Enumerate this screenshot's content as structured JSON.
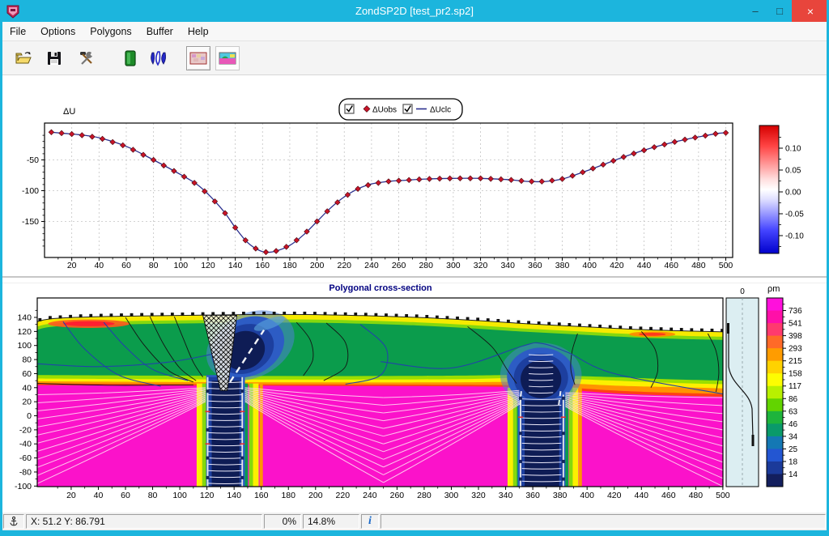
{
  "window": {
    "title": "ZondSP2D [test_pr2.sp2]",
    "minimize_label": "–",
    "maximize_label": "□",
    "close_label": "×",
    "titlebar_color": "#1cb5dd",
    "close_color": "#e8453c"
  },
  "menu": {
    "items": [
      "File",
      "Options",
      "Polygons",
      "Buffer",
      "Help"
    ]
  },
  "toolbar": {
    "buttons": [
      "open-file",
      "save-file",
      "tools-settings",
      "run-inversion",
      "wavelet-filter",
      "observed-data-view",
      "model-section-view"
    ]
  },
  "upper_chart": {
    "ylabel": "ΔU",
    "legend": [
      {
        "checked": true,
        "marker": "diamond",
        "label": "ΔUobs",
        "color": "#c81428"
      },
      {
        "checked": true,
        "marker": "line",
        "label": "ΔUclc",
        "color": "#2a2f8e"
      }
    ],
    "x_ticks": [
      20,
      40,
      60,
      80,
      100,
      120,
      140,
      160,
      180,
      200,
      220,
      240,
      260,
      280,
      300,
      320,
      340,
      360,
      380,
      400,
      420,
      440,
      460,
      480,
      500
    ],
    "y_ticks": [
      -50,
      -100,
      -150
    ],
    "colorbar_tick_labels": [
      "0.10",
      "0.05",
      "0.00",
      "-0.05",
      "-0.10"
    ]
  },
  "cross_section": {
    "title": "Polygonal cross-section",
    "x_ticks": [
      20,
      40,
      60,
      80,
      100,
      120,
      140,
      160,
      180,
      200,
      220,
      240,
      260,
      280,
      300,
      320,
      340,
      360,
      380,
      400,
      420,
      440,
      460,
      480,
      500
    ],
    "y_ticks": [
      140,
      120,
      100,
      80,
      60,
      40,
      20,
      0,
      -20,
      -40,
      -60,
      -80,
      -100
    ],
    "profile_axis_label": "0",
    "scale_label": "ρm",
    "scale_ticks": [
      736,
      541,
      398,
      293,
      215,
      158,
      117,
      86,
      63,
      46,
      34,
      25,
      18,
      14
    ],
    "scale_colors": [
      "#ff10dc",
      "#ff10a8",
      "#ff3a6e",
      "#ff6a28",
      "#ff9c00",
      "#ffd200",
      "#fdfd02",
      "#b8f000",
      "#62d400",
      "#1eb43c",
      "#0a9a6a",
      "#1478b4",
      "#2356d2",
      "#1b3a9a",
      "#131f5e"
    ]
  },
  "status_bar": {
    "coords": "X: 51.2 Y: 86.791",
    "left_percent": "0%",
    "right_percent": "14.8%",
    "info": "i"
  },
  "chart_data": [
    {
      "type": "line",
      "title": "",
      "xlabel": "",
      "ylabel": "ΔU",
      "xlim": [
        0,
        505
      ],
      "ylim": [
        -210,
        12
      ],
      "grid": true,
      "legend_position": "top-center",
      "series": [
        {
          "name": "ΔUobs",
          "marker": "diamond",
          "color": "#c81428",
          "x": [
            5,
            15,
            25,
            40,
            60,
            80,
            100,
            112,
            122,
            132,
            140,
            148,
            155,
            162,
            170,
            180,
            190,
            200,
            210,
            220,
            230,
            240,
            252,
            265,
            280,
            300,
            320,
            340,
            355,
            368,
            380,
            390,
            400,
            412,
            424,
            436,
            448,
            460,
            472,
            484,
            494,
            500
          ],
          "y": [
            -5,
            -7,
            -9,
            -14,
            -28,
            -50,
            -74,
            -90,
            -110,
            -135,
            -160,
            -182,
            -194,
            -200,
            -198,
            -189,
            -172,
            -150,
            -128,
            -110,
            -97,
            -89,
            -85,
            -83,
            -81,
            -80,
            -80,
            -82,
            -85,
            -85,
            -81,
            -74,
            -66,
            -56,
            -46,
            -37,
            -29,
            -22,
            -16,
            -11,
            -7,
            -6
          ]
        },
        {
          "name": "ΔUclc",
          "marker": "none",
          "color": "#2a2f8e",
          "note": "calculated curve, coincides with observed curve"
        }
      ],
      "colorbar": {
        "ticks": [
          0.1,
          0.05,
          0.0,
          -0.05,
          -0.1
        ],
        "top_color": "#dd0000",
        "mid_color": "#ffffff",
        "bottom_color": "#0000cc"
      }
    },
    {
      "type": "heatmap",
      "title": "Polygonal cross-section",
      "xlim": [
        -5,
        500
      ],
      "ylim": [
        -101,
        168
      ],
      "resistivity_scale": {
        "label": "ρm",
        "ticks": [
          736,
          541,
          398,
          293,
          215,
          158,
          117,
          86,
          63,
          46,
          34,
          25,
          18,
          14
        ],
        "colors": [
          "#ff10dc",
          "#ff10a8",
          "#ff3a6e",
          "#ff6a28",
          "#ff9c00",
          "#ffd200",
          "#fdfd02",
          "#b8f000",
          "#62d400",
          "#1eb43c",
          "#0a9a6a",
          "#1478b4",
          "#2356d2",
          "#1b3a9a",
          "#131f5e"
        ]
      },
      "features": {
        "surface": [
          [
            -5,
            134
          ],
          [
            5,
            138
          ],
          [
            30,
            140.5
          ],
          [
            70,
            142
          ],
          [
            110,
            143
          ],
          [
            150,
            144
          ],
          [
            195,
            144
          ],
          [
            235,
            142.5
          ],
          [
            275,
            140
          ],
          [
            315,
            136
          ],
          [
            355,
            131
          ],
          [
            395,
            127
          ],
          [
            435,
            123
          ],
          [
            475,
            120.5
          ],
          [
            500,
            119.5
          ]
        ],
        "band_curves": {
          "lightgreen": [
            [
              -5,
              58
            ],
            [
              100,
              57
            ],
            [
              200,
              56.5
            ],
            [
              300,
              57
            ],
            [
              360,
              58
            ],
            [
              420,
              55
            ],
            [
              460,
              52
            ],
            [
              500,
              50
            ]
          ],
          "yellow": [
            [
              -5,
              53
            ],
            [
              100,
              52
            ],
            [
              200,
              51.5
            ],
            [
              300,
              52
            ],
            [
              360,
              54
            ],
            [
              420,
              50
            ],
            [
              460,
              47
            ],
            [
              500,
              45
            ]
          ],
          "orange": [
            [
              -5,
              49
            ],
            [
              100,
              48
            ],
            [
              200,
              47.5
            ],
            [
              300,
              47.5
            ],
            [
              360,
              48
            ],
            [
              420,
              43
            ],
            [
              460,
              41
            ],
            [
              500,
              39
            ]
          ],
          "red": [
            [
              -5,
              46
            ],
            [
              100,
              45
            ],
            [
              200,
              44.5
            ],
            [
              300,
              44
            ],
            [
              360,
              43
            ],
            [
              420,
              36
            ],
            [
              460,
              33
            ],
            [
              500,
              31
            ]
          ],
          "magenta": [
            [
              -5,
              43.5
            ],
            [
              100,
              43
            ],
            [
              200,
              42.5
            ],
            [
              300,
              42
            ],
            [
              360,
              40
            ],
            [
              420,
              32
            ],
            [
              460,
              29
            ],
            [
              500,
              27
            ]
          ]
        },
        "anomalies": [
          {
            "x_range": [
              119.5,
              148
            ],
            "blob_center": [
              150,
              98
            ],
            "note": "left low-resistivity plume with lattice polygon at surface"
          },
          {
            "x_range": [
              349,
              384
            ],
            "blob_center": [
              366,
              56
            ],
            "note": "right low-resistivity plume"
          }
        ]
      }
    }
  ]
}
